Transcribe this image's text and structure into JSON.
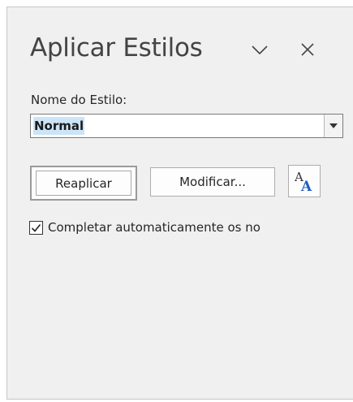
{
  "pane": {
    "title": "Aplicar Estilos",
    "chevron_icon": "chevron-down-icon",
    "close_icon": "close-icon"
  },
  "style_name": {
    "label": "Nome do Estilo:",
    "value": "Normal",
    "dropdown_icon": "dropdown-arrow-icon"
  },
  "buttons": {
    "reapply_label": "Reaplicar",
    "modify_label": "Modificar...",
    "styles_icon": "styles-icon"
  },
  "autocomplete": {
    "label": "Completar automaticamente os no",
    "checked": true
  },
  "colors": {
    "pane_background": "#f0f0f0",
    "selection_highlight": "#cce4f7",
    "style_icon_accent": "#1f5fbf"
  }
}
